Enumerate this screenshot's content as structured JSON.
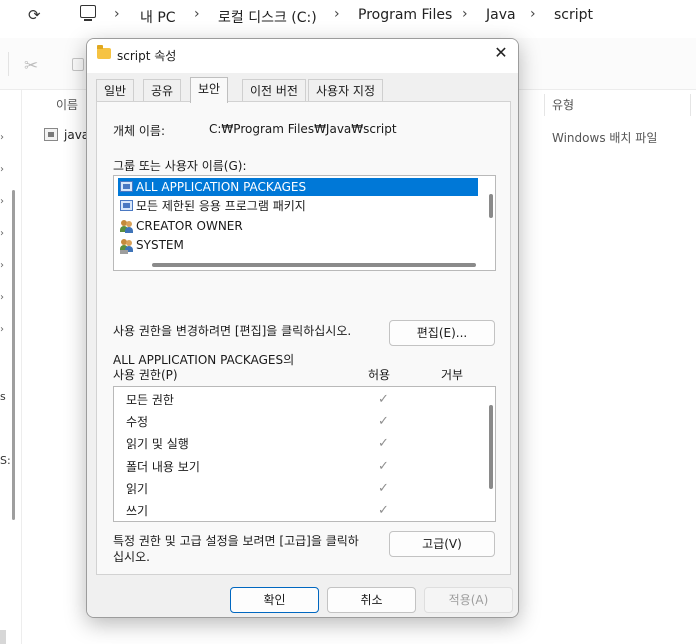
{
  "explorer": {
    "breadcrumb": [
      "내 PC",
      "로컬 디스크 (C:)",
      "Program Files",
      "Java",
      "script"
    ],
    "columns": {
      "name": "이름",
      "type": "유형"
    },
    "file": {
      "name": "java",
      "type": "Windows 배치 파일"
    },
    "nav_fragments": [
      "s",
      "S:"
    ],
    "icons": {
      "refresh": "refresh-icon",
      "pc": "computer-icon",
      "cut": "scissors-icon",
      "copy": "copy-icon"
    }
  },
  "dialog": {
    "title": "script 속성",
    "close_glyph": "✕",
    "tabs": [
      "일반",
      "공유",
      "보안",
      "이전 버전",
      "사용자 지정"
    ],
    "active_tab": "보안",
    "object_name_label": "개체 이름:",
    "object_name_value": "C:₩Program Files₩Java₩script",
    "groups_label": "그룹 또는 사용자 이름(G):",
    "groups": [
      {
        "name": "ALL APPLICATION PACKAGES",
        "icon": "package-icon",
        "selected": true
      },
      {
        "name": "모든 제한된 응용 프로그램 패키지",
        "icon": "package-icon",
        "selected": false
      },
      {
        "name": "CREATOR OWNER",
        "icon": "users-icon",
        "selected": false
      },
      {
        "name": "SYSTEM",
        "icon": "users-icon",
        "selected": false
      }
    ],
    "edit_hint": "사용 권한을 변경하려면 [편집]을 클릭하십시오.",
    "edit_button": "편집(E)...",
    "perm_title_line1": "ALL APPLICATION PACKAGES의",
    "perm_title_line2": "사용 권한(P)",
    "allow_header": "허용",
    "deny_header": "거부",
    "permissions": [
      {
        "name": "모든 권한",
        "allow": true,
        "deny": false
      },
      {
        "name": "수정",
        "allow": true,
        "deny": false
      },
      {
        "name": "읽기 및 실행",
        "allow": true,
        "deny": false
      },
      {
        "name": "폴더 내용 보기",
        "allow": true,
        "deny": false
      },
      {
        "name": "읽기",
        "allow": true,
        "deny": false
      },
      {
        "name": "쓰기",
        "allow": true,
        "deny": false
      }
    ],
    "advanced_hint_line1": "특정 권한 및 고급 설정을 보려면 [고급]을 클릭하",
    "advanced_hint_line2": "십시오.",
    "advanced_button": "고급(V)",
    "ok_button": "확인",
    "cancel_button": "취소",
    "apply_button": "적용(A)",
    "check_glyph": "✓",
    "selection_color": "#0078d7"
  }
}
